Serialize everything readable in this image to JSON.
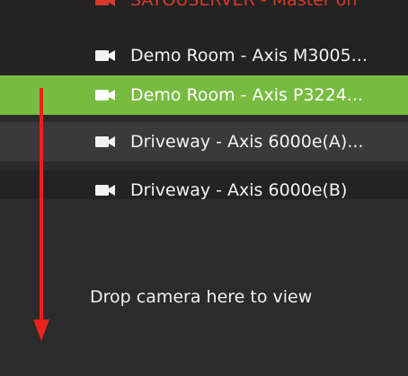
{
  "camera_list": {
    "items": [
      {
        "label": "SATOUSERVER - Master on",
        "state": "partially-visible",
        "color": "#d93a2b",
        "icon": "server-icon"
      },
      {
        "label": "Demo Room - Axis M3005...",
        "state": "normal",
        "icon": "camera-icon"
      },
      {
        "label": "Demo Room - Axis P3224...",
        "state": "selected",
        "icon": "camera-icon"
      },
      {
        "label": "Driveway - Axis 6000e(A)...",
        "state": "hover",
        "icon": "camera-icon"
      },
      {
        "label": "Driveway - Axis 6000e(B)",
        "state": "partially-visible",
        "icon": "camera-icon"
      }
    ]
  },
  "drop_zone": {
    "text": "Drop camera here to view"
  },
  "colors": {
    "selected_row": "#77bb41",
    "arrow": "#e8231c",
    "background": "#2b2b2b",
    "list_background": "#232323"
  },
  "annotation": {
    "icon": "down-arrow-icon"
  }
}
